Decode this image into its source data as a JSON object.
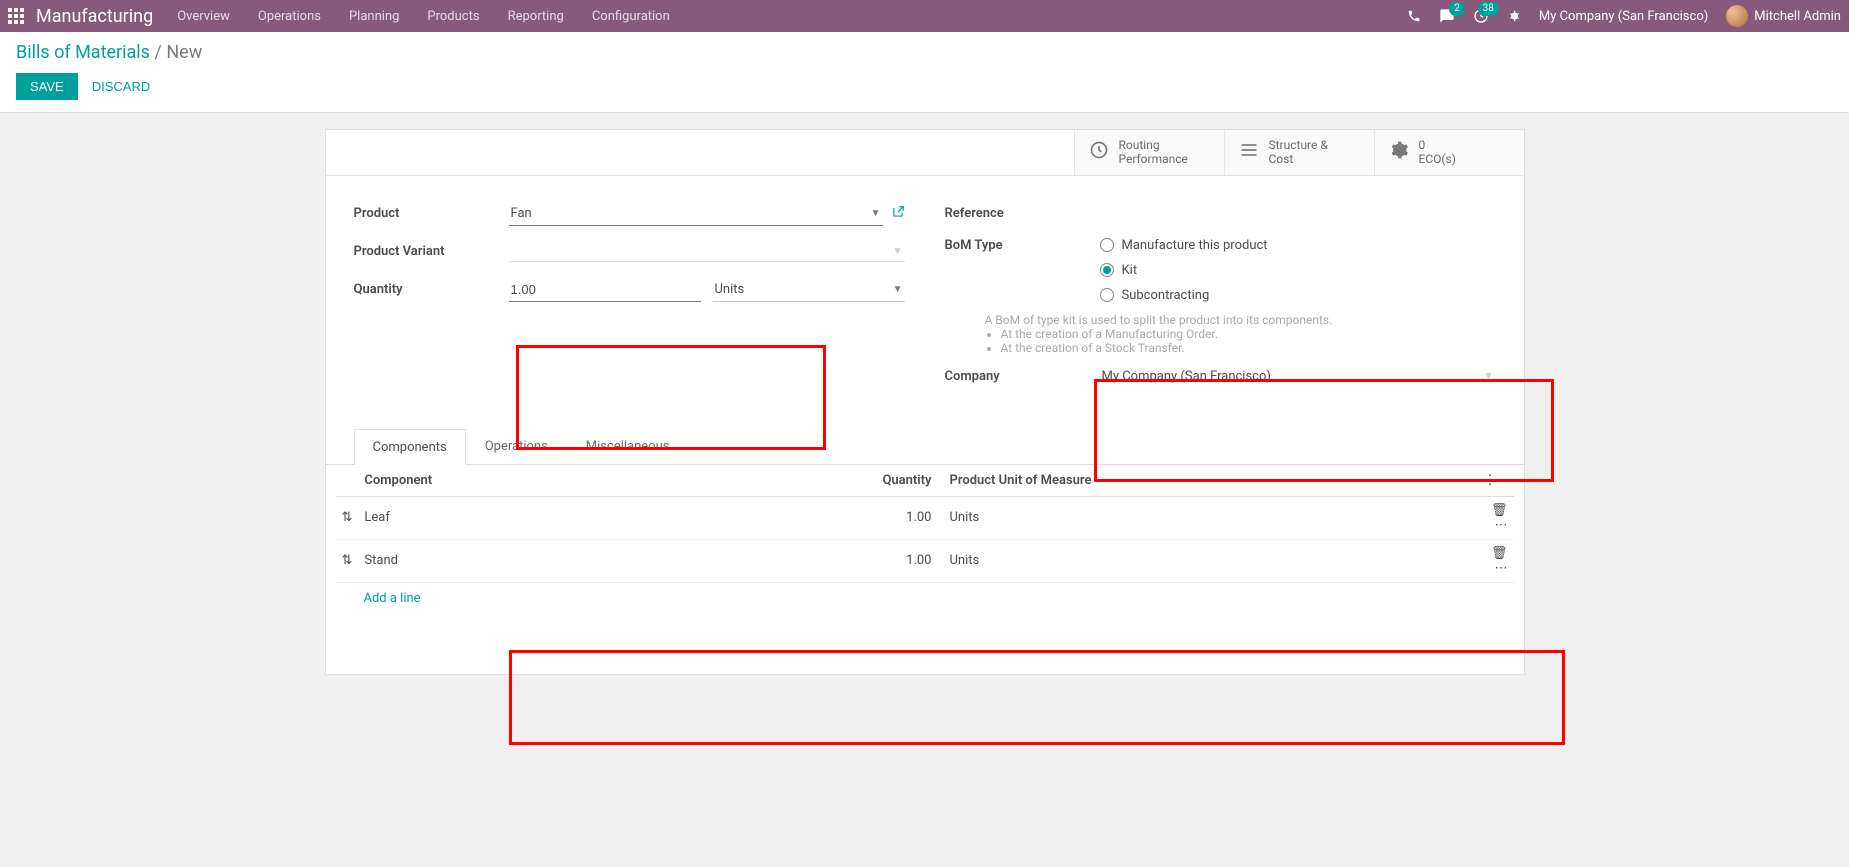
{
  "topbar": {
    "brand": "Manufacturing",
    "menu": [
      "Overview",
      "Operations",
      "Planning",
      "Products",
      "Reporting",
      "Configuration"
    ],
    "chat_badge": "2",
    "activity_badge": "38",
    "company": "My Company (San Francisco)",
    "user": "Mitchell Admin"
  },
  "breadcrumb": {
    "root": "Bills of Materials",
    "sep": " / ",
    "current": "New"
  },
  "actions": {
    "save": "SAVE",
    "discard": "DISCARD"
  },
  "stat_buttons": [
    {
      "line1": "Routing",
      "line2": "Performance"
    },
    {
      "line1": "Structure &",
      "line2": "Cost"
    },
    {
      "line1": "0",
      "line2": "ECO(s)"
    }
  ],
  "form": {
    "left": {
      "product_label": "Product",
      "product_value": "Fan",
      "variant_label": "Product Variant",
      "variant_value": "",
      "quantity_label": "Quantity",
      "quantity_value": "1.00",
      "unit_value": "Units"
    },
    "right": {
      "reference_label": "Reference",
      "reference_value": "",
      "bom_type_label": "BoM Type",
      "bom_options": [
        "Manufacture this product",
        "Kit",
        "Subcontracting"
      ],
      "bom_selected": "Kit",
      "help_line": "A BoM of type kit is used to split the product into its components.",
      "help_items": [
        "At the creation of a Manufacturing Order.",
        "At the creation of a Stock Transfer."
      ],
      "company_label": "Company",
      "company_value": "My Company (San Francisco)"
    }
  },
  "tabs": [
    "Components",
    "Operations",
    "Miscellaneous"
  ],
  "active_tab": "Components",
  "table": {
    "headers": {
      "component": "Component",
      "quantity": "Quantity",
      "uom": "Product Unit of Measure"
    },
    "rows": [
      {
        "component": "Leaf",
        "quantity": "1.00",
        "uom": "Units"
      },
      {
        "component": "Stand",
        "quantity": "1.00",
        "uom": "Units"
      }
    ],
    "add_line": "Add a line"
  }
}
